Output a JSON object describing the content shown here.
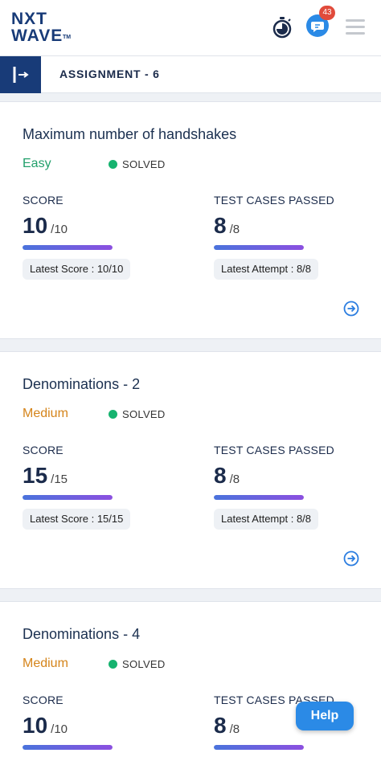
{
  "header": {
    "logo_line1": "NXT",
    "logo_line2": "WAVE",
    "logo_tm": "TM",
    "notification_count": "43",
    "brand_color": "#183b78",
    "accent_color": "#2b8ae6",
    "icons": [
      "stopwatch-icon",
      "chat-icon",
      "menu-icon"
    ]
  },
  "subheader": {
    "title": "ASSIGNMENT - 6",
    "collapse_icon": "sidebar-collapse-icon"
  },
  "questions": [
    {
      "title": "Maximum number of handshakes",
      "difficulty": "Easy",
      "status": "SOLVED",
      "score_label": "SCORE",
      "score": "10",
      "score_max": "/10",
      "score_fraction": 1,
      "latest_score": "Latest Score : 10/10",
      "tests_label": "TEST CASES PASSED",
      "tests_passed": "8",
      "tests_max": "/8",
      "tests_fraction": 1,
      "latest_attempt": "Latest Attempt : 8/8"
    },
    {
      "title": "Denominations - 2",
      "difficulty": "Medium",
      "status": "SOLVED",
      "score_label": "SCORE",
      "score": "15",
      "score_max": "/15",
      "score_fraction": 1,
      "latest_score": "Latest Score : 15/15",
      "tests_label": "TEST CASES PASSED",
      "tests_passed": "8",
      "tests_max": "/8",
      "tests_fraction": 1,
      "latest_attempt": "Latest Attempt : 8/8"
    },
    {
      "title": "Denominations - 4",
      "difficulty": "Medium",
      "status": "SOLVED",
      "score_label": "SCORE",
      "score": "10",
      "score_max": "/10",
      "score_fraction": 1,
      "tests_label": "TEST CASES PASSED",
      "tests_passed": "8",
      "tests_max": "/8",
      "tests_fraction": 1
    }
  ],
  "help": {
    "label": "Help"
  },
  "colors": {
    "easy": "#22a06b",
    "medium": "#d5841a",
    "solved": "#16b36f"
  }
}
